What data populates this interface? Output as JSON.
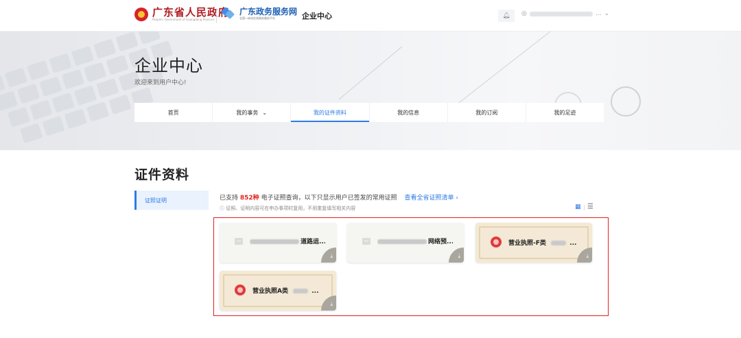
{
  "header": {
    "gov_title": "广东省人民政府",
    "gov_subtitle": "People's Government of Guangdong Province",
    "portal_title": "广东政务服务网",
    "portal_subtitle": "全国一体化在线政务服务平台",
    "nav_title": "企业中心",
    "bell_icon": "bell-icon",
    "user_dropdown_icon": "chevron-down-icon",
    "user_ellipsis": "..."
  },
  "hero": {
    "title": "企业中心",
    "subtitle": "欢迎来到用户中心!",
    "tabs": [
      {
        "label": "首页"
      },
      {
        "label": "我的事务"
      },
      {
        "label": "我的证件资料"
      },
      {
        "label": "我的信息"
      },
      {
        "label": "我的订阅"
      },
      {
        "label": "我的足迹"
      }
    ],
    "active_tab": "我的证件资料"
  },
  "section": {
    "title": "证件资料",
    "side_tab": "证照证明",
    "info_prefix": "已支持",
    "info_count": "852种",
    "info_suffix": "电子证照查询，以下只显示用户已签发的常用证照",
    "info_link": "查看全省证照清单 ›",
    "tip": "ⓘ 证照、证明内容可在申办事项时复用，不用重复填写相关内容",
    "view_grid_icon": "grid-icon",
    "view_list_icon": "list-icon"
  },
  "cards": [
    {
      "title": "道路运...",
      "style": "plain",
      "icon": "document-icon"
    },
    {
      "title": "网络预...",
      "style": "plain",
      "icon": "document-icon"
    },
    {
      "title": "营业执照-F类",
      "suffix": "...",
      "style": "gold",
      "icon": "seal-icon"
    },
    {
      "title": "营业执照A类",
      "suffix": "...",
      "style": "gold",
      "icon": "seal-icon"
    }
  ],
  "colors": {
    "accent": "#2d7be5",
    "highlight_red": "#e02020",
    "gov_red": "#b01c23"
  }
}
